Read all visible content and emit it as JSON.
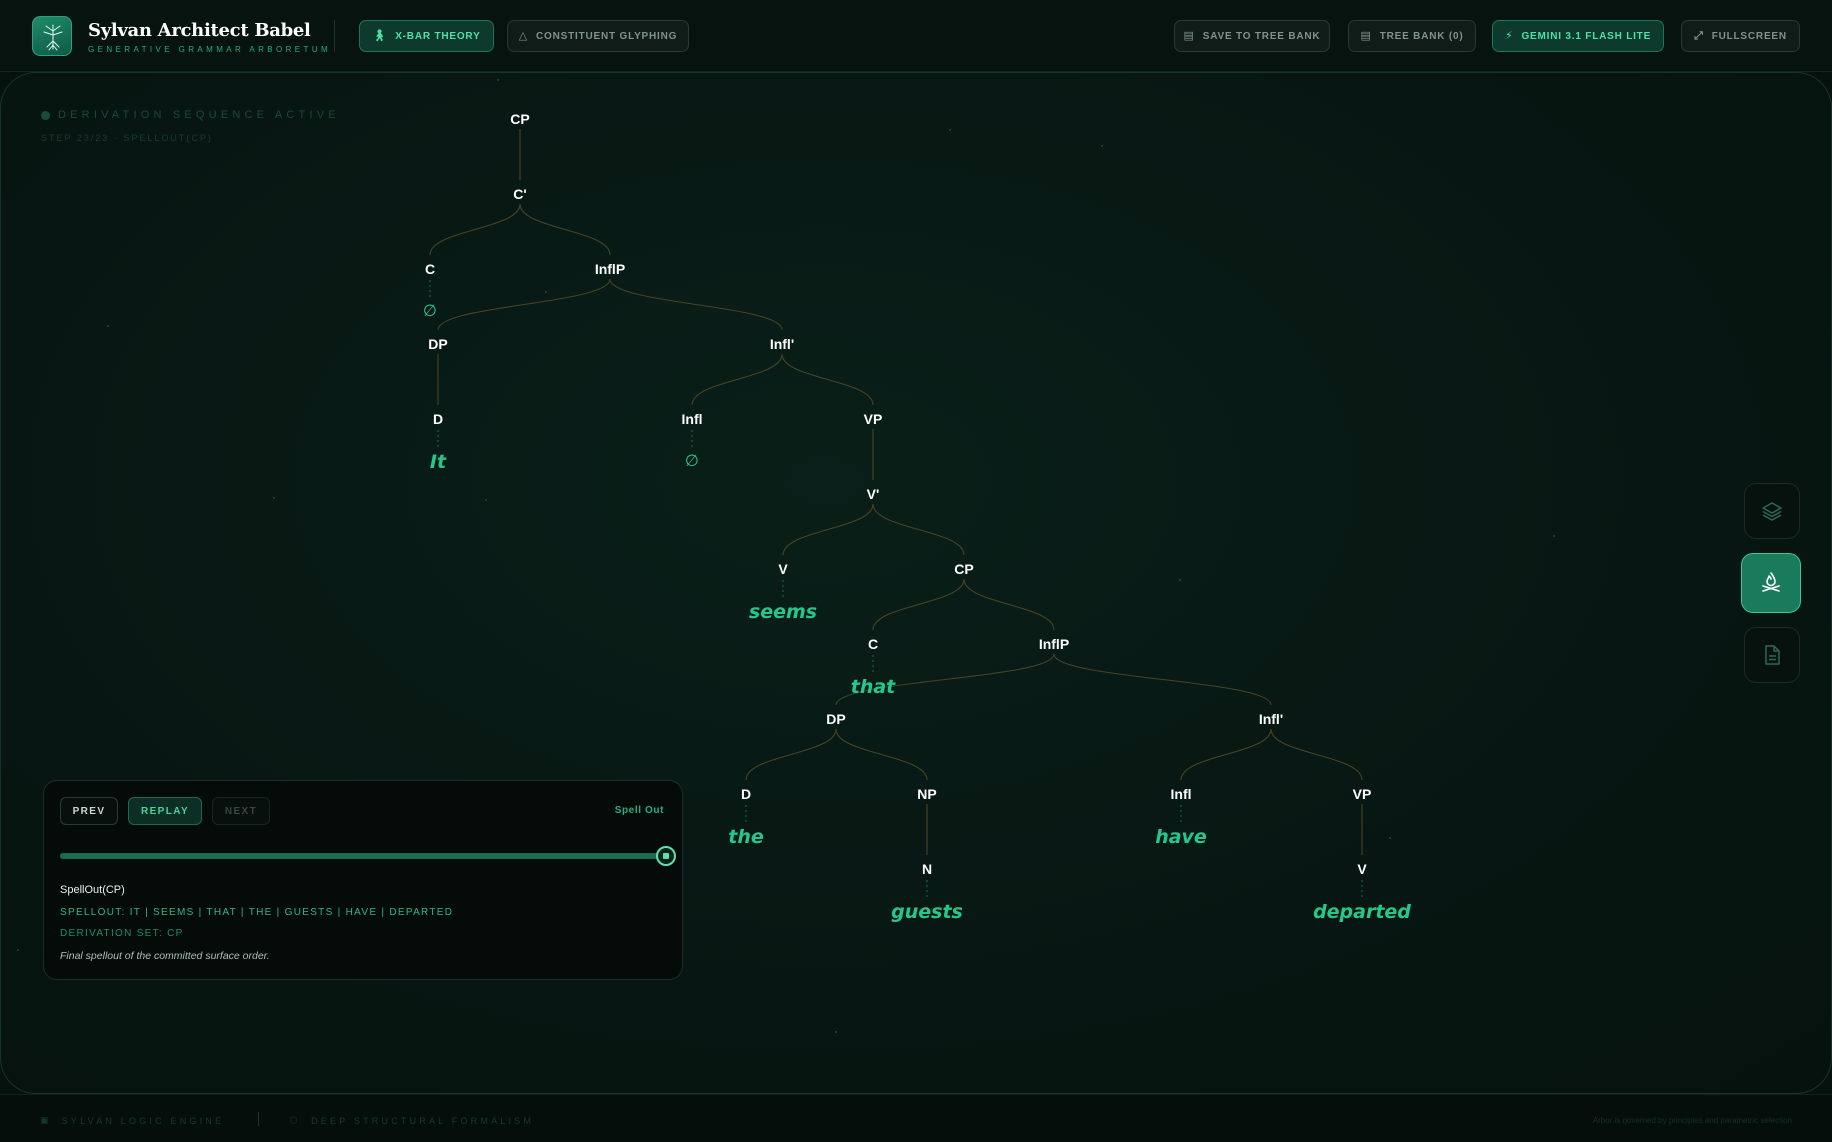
{
  "app": {
    "title": "Sylvan Architect Babel",
    "subtitle": "Generative Grammar Arboretum"
  },
  "header": {
    "tabs": [
      {
        "label": "X-Bar Theory",
        "icon": "person-icon",
        "active": true
      },
      {
        "label": "Constituent Glyphing",
        "icon": "triangle-icon",
        "active": false
      }
    ],
    "actions": [
      {
        "label": "Save to Tree Bank",
        "icon": "archive-icon"
      },
      {
        "label": "Tree Bank (0)",
        "icon": "archive-icon"
      },
      {
        "label": "Gemini 3.1 Flash Lite",
        "icon": "bolt-icon",
        "highlight": true
      },
      {
        "label": "Fullscreen",
        "icon": "expand-icon"
      }
    ]
  },
  "status": {
    "line": "Derivation Sequence Active",
    "step": "Step 23/23 · SpellOut(CP)"
  },
  "tree": {
    "nodes": [
      {
        "id": "cp1",
        "label": "CP",
        "parent": null
      },
      {
        "id": "cbar1",
        "label": "C'",
        "parent": "cp1"
      },
      {
        "id": "c1",
        "label": "C",
        "parent": "cbar1",
        "word": "∅",
        "null": true
      },
      {
        "id": "ip1",
        "label": "InflP",
        "parent": "cbar1"
      },
      {
        "id": "dp1",
        "label": "DP",
        "parent": "ip1"
      },
      {
        "id": "d1",
        "label": "D",
        "parent": "dp1",
        "word": "It"
      },
      {
        "id": "ibar1",
        "label": "Infl'",
        "parent": "ip1"
      },
      {
        "id": "infl1",
        "label": "Infl",
        "parent": "ibar1",
        "word": "∅",
        "null": true
      },
      {
        "id": "vp1",
        "label": "VP",
        "parent": "ibar1"
      },
      {
        "id": "vbar1",
        "label": "V'",
        "parent": "vp1"
      },
      {
        "id": "v1",
        "label": "V",
        "parent": "vbar1",
        "word": "seems"
      },
      {
        "id": "cp2",
        "label": "CP",
        "parent": "vbar1"
      },
      {
        "id": "c2",
        "label": "C",
        "parent": "cp2",
        "word": "that"
      },
      {
        "id": "ip2",
        "label": "InflP",
        "parent": "cp2"
      },
      {
        "id": "dp2",
        "label": "DP",
        "parent": "ip2"
      },
      {
        "id": "d2",
        "label": "D",
        "parent": "dp2",
        "word": "the"
      },
      {
        "id": "np2",
        "label": "NP",
        "parent": "dp2"
      },
      {
        "id": "n2",
        "label": "N",
        "parent": "np2",
        "word": "guests"
      },
      {
        "id": "ibar2",
        "label": "Infl'",
        "parent": "ip2"
      },
      {
        "id": "infl2",
        "label": "Infl",
        "parent": "ibar2",
        "word": "have"
      },
      {
        "id": "vp2",
        "label": "VP",
        "parent": "ibar2"
      },
      {
        "id": "v2",
        "label": "V",
        "parent": "vp2",
        "word": "departed"
      }
    ]
  },
  "controls": {
    "prev": "Prev",
    "replay": "Replay",
    "next": "Next",
    "mode": "Spell Out",
    "progress": 1.0,
    "step_name": "SpellOut(CP)",
    "spellout": "Spellout: It | seems | that | the | guests | have | departed",
    "derivation_set": "Derivation Set: CP",
    "description": "Final spellout of the committed surface order."
  },
  "rail": [
    {
      "icon": "layers-icon",
      "active": false
    },
    {
      "icon": "campfire-icon",
      "active": true
    },
    {
      "icon": "document-icon",
      "active": false
    }
  ],
  "footer": {
    "left": "Sylvan Logic Engine",
    "middle": "Deep Structural Formalism",
    "right": "Arbor is governed by principles and parametric selection"
  },
  "colors": {
    "accent": "#22c88e",
    "edge": "#4a4325",
    "background": "#06120e"
  }
}
